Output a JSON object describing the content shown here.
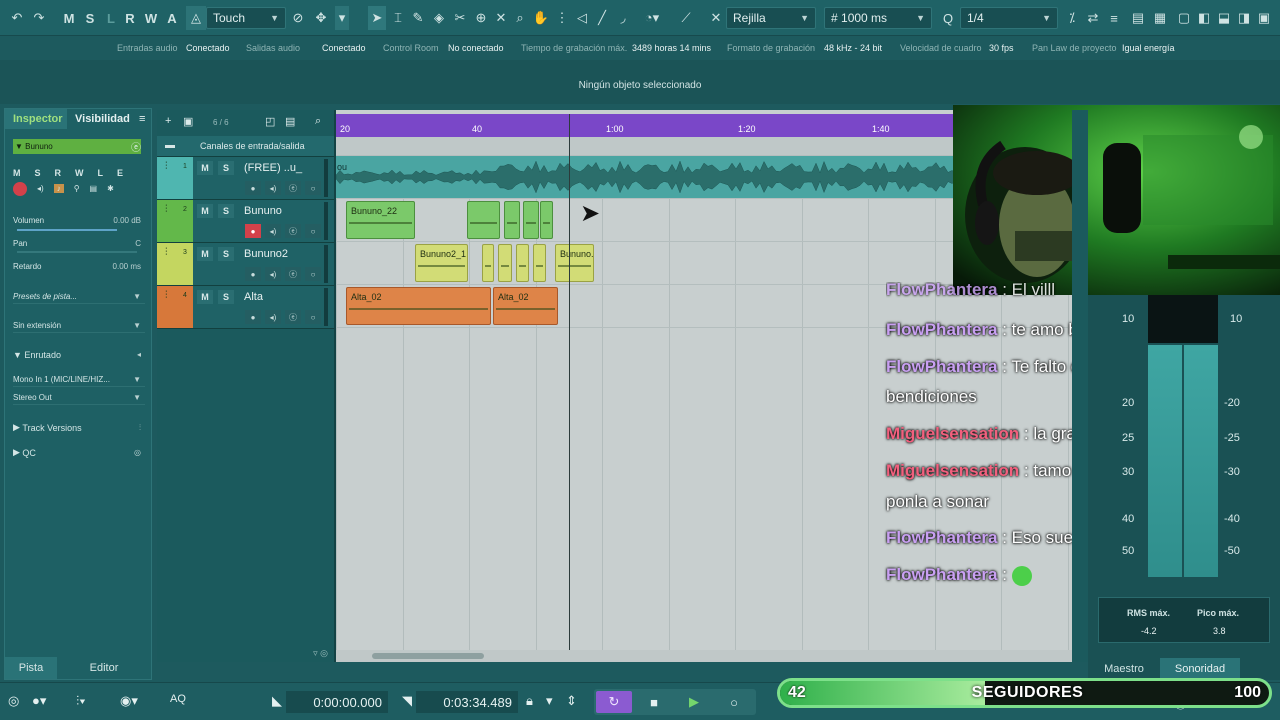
{
  "toolbar": {
    "modes": [
      "M",
      "S",
      "L",
      "R",
      "W",
      "A"
    ],
    "touch_mode": "Touch",
    "snap_type": "Rejilla",
    "grid_value": "1000 ms",
    "quantize": "1/4"
  },
  "status": {
    "input_label": "Entradas audio",
    "input_value": "Conectado",
    "output_label": "Salidas audio",
    "output_value": "Conectado",
    "control_room_label": "Control Room",
    "control_room_value": "No conectado",
    "rec_time_label": "Tiempo de grabación máx.",
    "rec_time_value": "3489 horas 14 mins",
    "format_label": "Formato de grabación",
    "format_value": "48 kHz - 24 bit",
    "fps_label": "Velocidad de cuadro",
    "fps_value": "30 fps",
    "panlaw_label": "Pan Law de proyecto",
    "panlaw_value": "Igual energía"
  },
  "info_line": "Ningún objeto seleccionado",
  "inspector": {
    "tab_inspector": "Inspector",
    "tab_visibility": "Visibilidad",
    "selected_track": "Bununo",
    "track_buttons": [
      "M",
      "S",
      "R",
      "W",
      "L",
      "E"
    ],
    "volume_label": "Volumen",
    "volume_value": "0.00 dB",
    "pan_label": "Pan",
    "pan_value": "C",
    "delay_label": "Retardo",
    "delay_value": "0.00 ms",
    "presets": "Presets de pista...",
    "extension": "Sin extensión",
    "routing": "Enrutado",
    "input_routing": "Mono In 1 (MIC/LINE/HIZ...",
    "output_routing": "Stereo Out",
    "track_versions": "Track Versions",
    "qc": "QC",
    "bottom_pista": "Pista",
    "bottom_editor": "Editor"
  },
  "tracklist": {
    "count": "6 / 6",
    "folder": "Canales de entrada/salida",
    "tracks": [
      {
        "num": "1",
        "name": "(FREE) ..u_",
        "color": "#4fb6b0"
      },
      {
        "num": "2",
        "name": "Bununo",
        "color": "#63b84a"
      },
      {
        "num": "3",
        "name": "Bununo2",
        "color": "#c4d660"
      },
      {
        "num": "4",
        "name": "Alta",
        "color": "#d7783a"
      }
    ],
    "m_label": "M",
    "s_label": "S"
  },
  "ruler": {
    "ticks": [
      "20",
      "40",
      "1:00",
      "1:20",
      "1:40"
    ]
  },
  "events": {
    "e1": "ou",
    "e2": "Bununo_22",
    "e3": "Bununo2_1",
    "e4": "Bununo.",
    "e5": "Alta_02",
    "e6": "Alta_02"
  },
  "chat": [
    {
      "user": "FlowPhantera",
      "sep": " : ",
      "msg": "El villl",
      "color": "#c9a0f2"
    },
    {
      "user": "FlowPhantera",
      "sep": " : ",
      "msg": "te amo bro",
      "color": "#c9a0f2"
    },
    {
      "user": "FlowPhantera",
      "sep": " : ",
      "msg": "Te falto decir va pal día..",
      "cont": "bendiciones",
      "color": "#c9a0f2"
    },
    {
      "user": "Miguelsensation",
      "sep": " : ",
      "msg": "la grasaaaa",
      "color": "#f2607e"
    },
    {
      "user": "Miguelsensation",
      "sep": " : ",
      "msg": "tamo activo tu sabe",
      "cont": "ponla a sonar",
      "color": "#f2607e"
    },
    {
      "user": "FlowPhantera",
      "sep": " : ",
      "msg": "Eso suena dulce",
      "color": "#c9a0f2"
    },
    {
      "user": "FlowPhantera",
      "sep": " : ",
      "msg": "",
      "color": "#c9a0f2"
    }
  ],
  "meter": {
    "scale_left": [
      "10",
      "20",
      "25",
      "30",
      "40",
      "50"
    ],
    "scale_right": [
      "10",
      "-20",
      "-25",
      "-30",
      "-40",
      "-50"
    ],
    "rms_label": "RMS máx.",
    "rms_value": "-4.2",
    "peak_label": "Pico máx.",
    "peak_value": "3.8",
    "tab_master": "Maestro",
    "tab_loudness": "Sonoridad"
  },
  "transport": {
    "position": "0:00:00.000",
    "length": "0:03:34.489",
    "aq": "AQ"
  },
  "followers": {
    "current": "42",
    "goal": "100",
    "label": "SEGUIDORES",
    "progress": 0.42
  }
}
